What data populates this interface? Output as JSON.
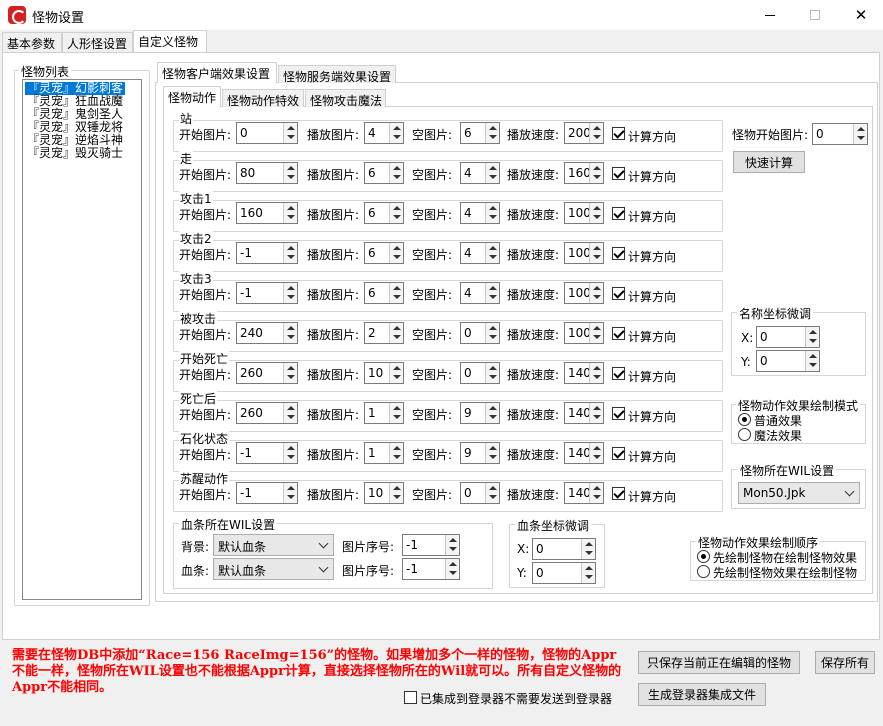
{
  "window": {
    "title": "怪物设置",
    "min_icon": "minimize-icon",
    "max_icon": "maximize-icon",
    "close_icon": "close-icon",
    "close_glyph": "✕"
  },
  "main_tabs": [
    "基本参数",
    "人形怪设置",
    "自定义怪物"
  ],
  "monster_list": {
    "label": "怪物列表",
    "items": [
      "『灵宠』幻影刺客",
      "『灵宠』狂血战魔",
      "『灵宠』鬼剑圣人",
      "『灵宠』双锤龙将",
      "『灵宠』逆焰斗神",
      "『灵宠』毁灭骑士"
    ]
  },
  "effect_tabs": [
    "怪物客户端效果设置",
    "怪物服务端效果设置"
  ],
  "sub_tabs": [
    "怪物动作",
    "怪物动作特效",
    "怪物攻击魔法"
  ],
  "field_labels": {
    "start": "开始图片:",
    "play": "播放图片:",
    "empty": "空图片:",
    "speed": "播放速度:",
    "calc_dir": "计算方向"
  },
  "actions": [
    {
      "name": "站",
      "start": "0",
      "play": "4",
      "empty": "6",
      "speed": "200",
      "calc": true
    },
    {
      "name": "走",
      "start": "80",
      "play": "6",
      "empty": "4",
      "speed": "160",
      "calc": true
    },
    {
      "name": "攻击1",
      "start": "160",
      "play": "6",
      "empty": "4",
      "speed": "100",
      "calc": true
    },
    {
      "name": "攻击2",
      "start": "-1",
      "play": "6",
      "empty": "4",
      "speed": "100",
      "calc": true
    },
    {
      "name": "攻击3",
      "start": "-1",
      "play": "6",
      "empty": "4",
      "speed": "100",
      "calc": true
    },
    {
      "name": "被攻击",
      "start": "240",
      "play": "2",
      "empty": "0",
      "speed": "100",
      "calc": true
    },
    {
      "name": "开始死亡",
      "start": "260",
      "play": "10",
      "empty": "0",
      "speed": "140",
      "calc": true
    },
    {
      "name": "死亡后",
      "start": "260",
      "play": "1",
      "empty": "9",
      "speed": "140",
      "calc": true
    },
    {
      "name": "石化状态",
      "start": "-1",
      "play": "1",
      "empty": "9",
      "speed": "140",
      "calc": true
    },
    {
      "name": "苏醒动作",
      "start": "-1",
      "play": "10",
      "empty": "0",
      "speed": "140",
      "calc": true
    }
  ],
  "right_panel": {
    "monster_start_label": "怪物开始图片:",
    "monster_start_value": "0",
    "quick_calc": "快速计算",
    "name_offset_label": "名称坐标微调",
    "x_label": "X:",
    "y_label": "Y:",
    "name_x": "0",
    "name_y": "0",
    "draw_mode_label": "怪物动作效果绘制模式",
    "draw_mode_options": [
      "普通效果",
      "魔法效果"
    ],
    "draw_mode_selected": 0,
    "wil_label": "怪物所在WIL设置",
    "wil_value": "Mon50.Jpk"
  },
  "hp_bar": {
    "label": "血条所在WIL设置",
    "bg_label": "背景:",
    "bg_value": "默认血条",
    "bar_label": "血条:",
    "bar_value": "默认血条",
    "img_index_label": "图片序号:",
    "bg_index": "-1",
    "bar_index": "-1"
  },
  "hp_offset": {
    "label": "血条坐标微调",
    "x_label": "X:",
    "y_label": "Y:",
    "x": "0",
    "y": "0"
  },
  "draw_order": {
    "label": "怪物动作效果绘制顺序",
    "options": [
      "先绘制怪物在绘制怪物效果",
      "先绘制怪物效果在绘制怪物"
    ],
    "selected": 0
  },
  "notice": "需要在怪物DB中添加“Race=156 RaceImg=156”的怪物。如果增加多个一样的怪物，怪物的Appr不能一样，怪物所在WIL设置也不能根据Appr计算，直接选择怪物所在的Wil就可以。所有自定义怪物的Appr不能相同。",
  "footer": {
    "integrated_label": "已集成到登录器不需要发送到登录器",
    "integrated_checked": false,
    "save_current": "只保存当前正在编辑的怪物",
    "save_all": "保存所有",
    "gen_file": "生成登录器集成文件"
  }
}
